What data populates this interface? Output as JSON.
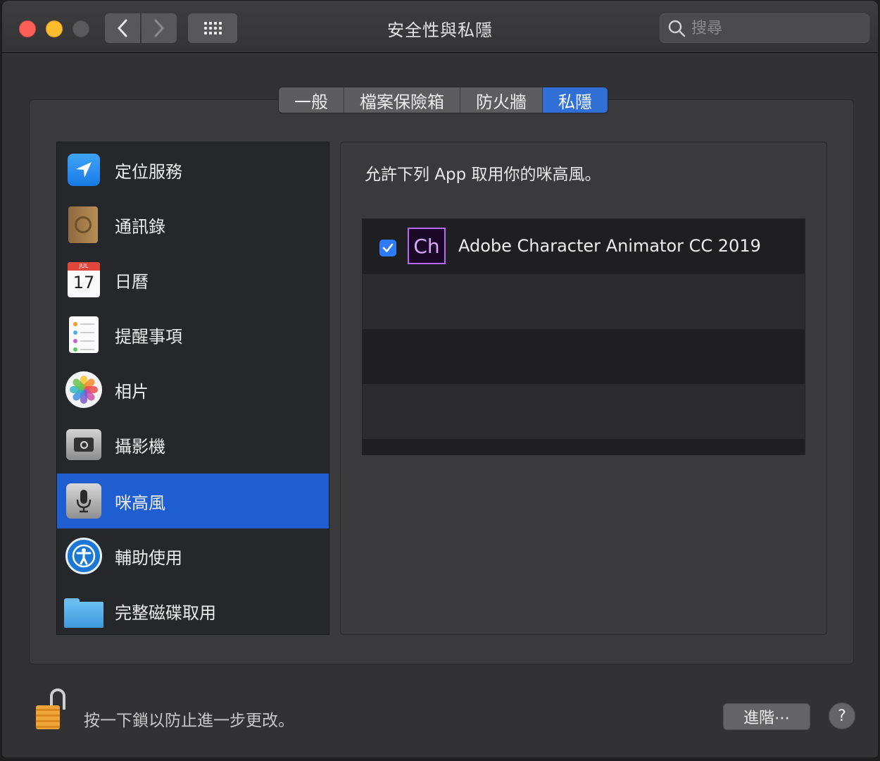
{
  "window": {
    "title": "安全性與私隱"
  },
  "search": {
    "placeholder": "搜尋"
  },
  "tabs": [
    {
      "label": "一般",
      "active": false
    },
    {
      "label": "檔案保險箱",
      "active": false
    },
    {
      "label": "防火牆",
      "active": false
    },
    {
      "label": "私隱",
      "active": true
    }
  ],
  "sidebar": {
    "items": [
      {
        "label": "定位服務",
        "icon": "location-icon"
      },
      {
        "label": "通訊錄",
        "icon": "contacts-icon"
      },
      {
        "label": "日曆",
        "icon": "calendar-icon",
        "month": "JUL",
        "day": "17"
      },
      {
        "label": "提醒事項",
        "icon": "reminders-icon"
      },
      {
        "label": "相片",
        "icon": "photos-icon"
      },
      {
        "label": "攝影機",
        "icon": "camera-icon"
      },
      {
        "label": "咪高風",
        "icon": "microphone-icon",
        "selected": true
      },
      {
        "label": "輔助使用",
        "icon": "accessibility-icon"
      },
      {
        "label": "完整磁碟取用",
        "icon": "folder-icon"
      }
    ]
  },
  "detail": {
    "title": "允許下列 App 取用你的咪高風。",
    "apps": [
      {
        "name": "Adobe Character Animator CC 2019",
        "icon_text": "Ch",
        "checked": true
      }
    ]
  },
  "footer": {
    "lock_text": "按一下鎖以防止進一步更改。",
    "advanced_label": "進階⋯",
    "help_label": "?"
  },
  "colors": {
    "accent": "#1f5ed1",
    "tab_active": "#2f6fd6",
    "checkbox": "#2f7bf6"
  }
}
